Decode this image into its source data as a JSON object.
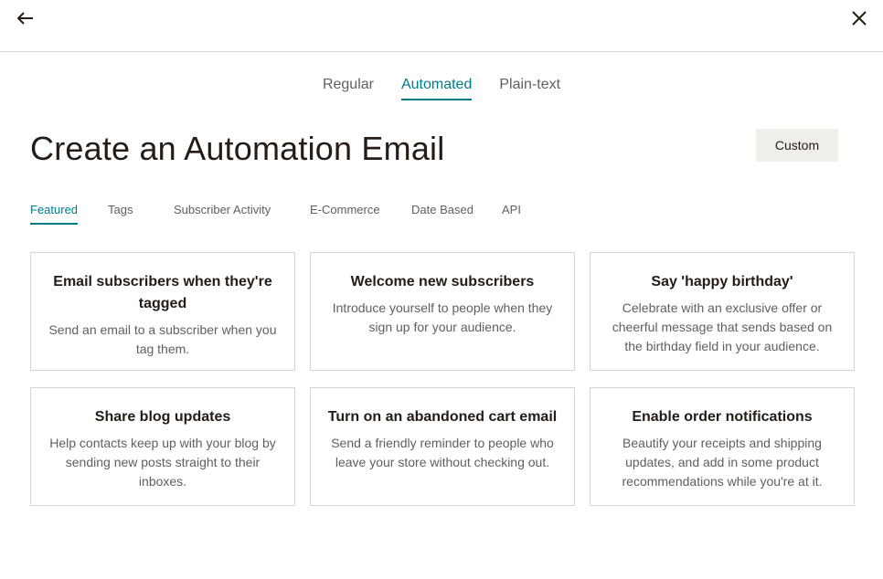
{
  "topbar": {
    "back_icon": "arrow-left-icon",
    "close_icon": "close-icon"
  },
  "type_tabs": [
    {
      "label": "Regular",
      "active": false
    },
    {
      "label": "Automated",
      "active": true
    },
    {
      "label": "Plain-text",
      "active": false
    }
  ],
  "page_title": "Create an Automation Email",
  "custom_button_label": "Custom",
  "category_tabs": [
    {
      "label": "Featured",
      "active": true
    },
    {
      "label": "Tags",
      "active": false
    },
    {
      "label": "Subscriber Activity",
      "active": false
    },
    {
      "label": "E-Commerce",
      "active": false
    },
    {
      "label": "Date Based",
      "active": false
    },
    {
      "label": "API",
      "active": false
    }
  ],
  "cards": [
    {
      "title": "Email subscribers when they're tagged",
      "description": "Send an email to a subscriber when you tag them."
    },
    {
      "title": "Welcome new subscribers",
      "description": "Introduce yourself to people when they sign up for your audience."
    },
    {
      "title": "Say 'happy birthday'",
      "description": "Celebrate with an exclusive offer or cheerful message that sends based on the birthday field in your audience."
    },
    {
      "title": "Share blog updates",
      "description": "Help contacts keep up with your blog by sending new posts straight to their inboxes."
    },
    {
      "title": "Turn on an abandoned cart email",
      "description": "Send a friendly reminder to people who leave your store without checking out."
    },
    {
      "title": "Enable order notifications",
      "description": "Beautify your receipts and shipping updates, and add in some product recommendations while you're at it."
    }
  ],
  "colors": {
    "accent": "#007c89",
    "text": "#241c15",
    "muted": "#5f5f5f",
    "button_bg": "#efeeea",
    "border": "#d5d5d5"
  }
}
